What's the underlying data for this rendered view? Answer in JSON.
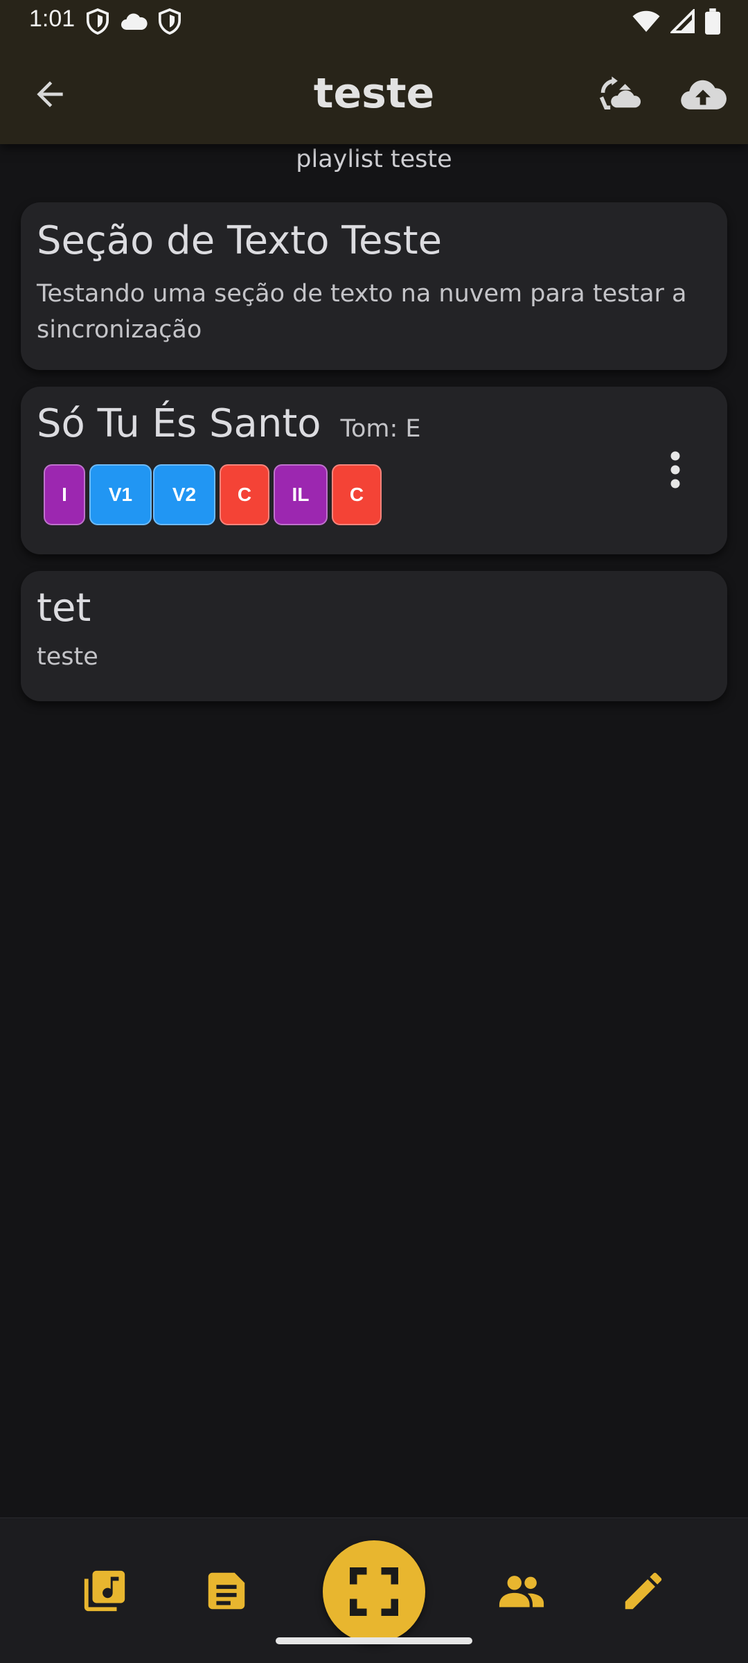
{
  "status_bar": {
    "time": "1:01"
  },
  "app_bar": {
    "title": "teste",
    "icons": [
      "back-arrow-icon",
      "cloud-sync-icon",
      "cloud-upload-icon"
    ]
  },
  "playlist": {
    "subtitle": "playlist teste",
    "items": [
      {
        "type": "text",
        "title": "Seção de Texto Teste",
        "body": "Testando uma seção de texto na nuvem para testar a sincronização"
      },
      {
        "type": "song",
        "title": "Só Tu És Santo",
        "key_label": "Tom: E",
        "sections": [
          {
            "label": "I",
            "color": "#9c27b0"
          },
          {
            "label": "V1",
            "color": "#2196f3"
          },
          {
            "label": "V2",
            "color": "#2196f3"
          },
          {
            "label": "C",
            "color": "#f44336"
          },
          {
            "label": "IL",
            "color": "#9c27b0"
          },
          {
            "label": "C",
            "color": "#f44336"
          }
        ]
      },
      {
        "type": "text",
        "title": "tet",
        "body": "teste"
      }
    ]
  },
  "bottom_nav": {
    "accent_color": "#e8b62f",
    "items": [
      "music-library-icon",
      "document-icon",
      "fullscreen-icon",
      "people-icon",
      "edit-pencil-icon"
    ]
  }
}
